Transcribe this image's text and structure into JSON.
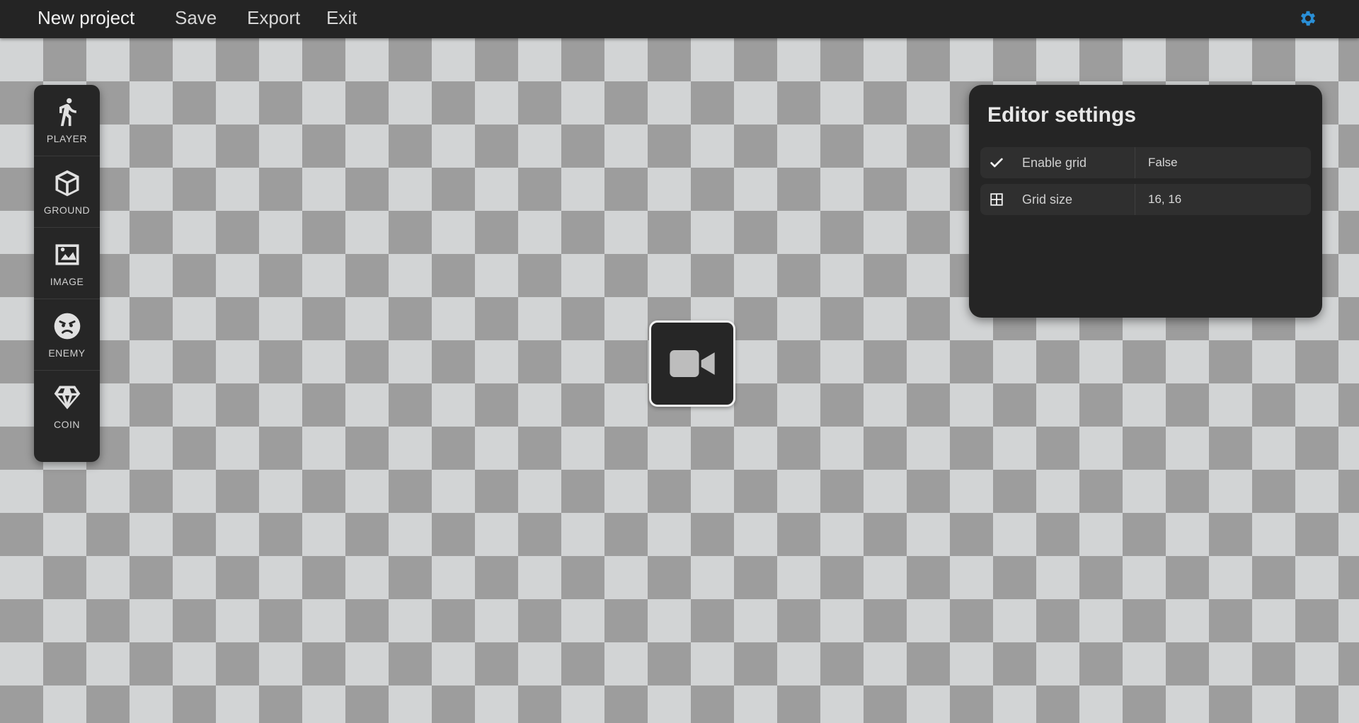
{
  "header": {
    "title": "New project",
    "menu": [
      {
        "label": "Save"
      },
      {
        "label": "Export"
      },
      {
        "label": "Exit"
      }
    ],
    "settings_icon": "gear-icon",
    "accent_color": "#2a8fd6"
  },
  "toolbar": {
    "items": [
      {
        "label": "PLAYER",
        "icon": "walking-person-icon"
      },
      {
        "label": "GROUND",
        "icon": "cube-icon"
      },
      {
        "label": "IMAGE",
        "icon": "image-icon"
      },
      {
        "label": "ENEMY",
        "icon": "angry-face-icon"
      },
      {
        "label": "COIN",
        "icon": "diamond-icon"
      }
    ]
  },
  "canvas": {
    "camera_icon": "video-camera-icon",
    "checker_light": "#d2d4d5",
    "checker_dark": "#9d9d9d"
  },
  "settings_panel": {
    "title": "Editor settings",
    "rows": [
      {
        "icon": "checkmark-icon",
        "name": "Enable grid",
        "value": "False"
      },
      {
        "icon": "grid-icon",
        "name": "Grid size",
        "value": "16, 16"
      }
    ]
  }
}
